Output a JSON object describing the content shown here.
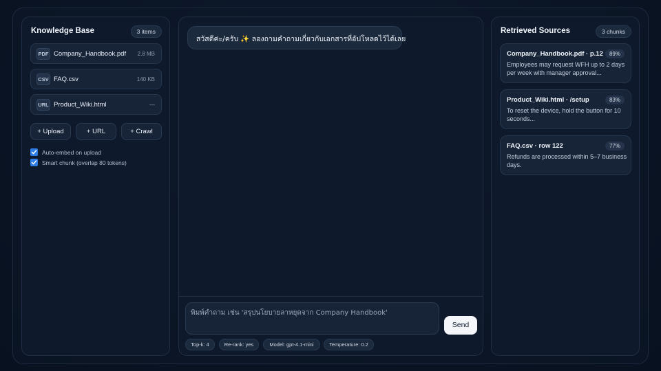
{
  "knowledge_base": {
    "title": "Knowledge Base",
    "count_label": "3 items",
    "files": [
      {
        "type": "PDF",
        "name": "Company_Handbook.pdf",
        "size": "2.8 MB"
      },
      {
        "type": "CSV",
        "name": "FAQ.csv",
        "size": "140 KB"
      },
      {
        "type": "URL",
        "name": "Product_Wiki.html",
        "size": "—"
      }
    ],
    "buttons": {
      "upload": "+ Upload",
      "url": "+ URL",
      "crawl": "+ Crawl"
    },
    "options": [
      {
        "label": "Auto-embed on upload",
        "checked": true
      },
      {
        "label": "Smart chunk (overlap 80 tokens)",
        "checked": true
      }
    ]
  },
  "chat": {
    "greeting": "สวัสดีค่ะ/ครับ ✨ ลองถามคำถามเกี่ยวกับเอกสารที่อัปโหลดไว้ได้เลย",
    "input_placeholder": "พิมพ์คำถาม เช่น 'สรุปนโยบายลาหยุดจาก Company Handbook'",
    "send_label": "Send",
    "settings": {
      "topk": "Top-k: 4",
      "rerank": "Re-rank: yes",
      "model": "Model: gpt-4.1-mini",
      "temperature": "Temperature: 0.2"
    }
  },
  "sources": {
    "title": "Retrieved Sources",
    "count_label": "3 chunks",
    "items": [
      {
        "title": "Company_Handbook.pdf · p.12",
        "score": "89%",
        "snippet": "Employees may request WFH up to 2 days per week with manager approval..."
      },
      {
        "title": "Product_Wiki.html · /setup",
        "score": "83%",
        "snippet": "To reset the device, hold the button for 10 seconds..."
      },
      {
        "title": "FAQ.csv · row 122",
        "score": "77%",
        "snippet": "Refunds are processed within 5–7 business days."
      }
    ]
  },
  "colors": {
    "background": "#0a1424",
    "panel": "#0e1a2c",
    "accent": "#2f7ee8",
    "send_button": "#f4f6fa"
  }
}
